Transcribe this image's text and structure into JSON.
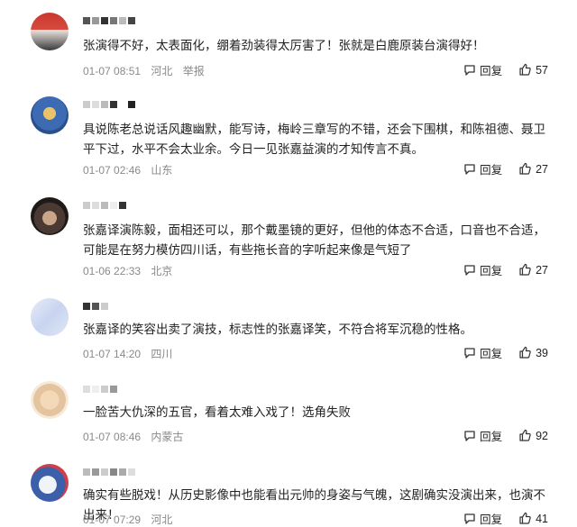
{
  "ui": {
    "reply_label": "回复"
  },
  "comments": [
    {
      "text": "张演得不好，太表面化，绷着劲装得太厉害了！张就是白鹿原装台演得好！",
      "time": "01-07 08:51",
      "location": "河北",
      "report": "举报",
      "likes": "57"
    },
    {
      "text": "具说陈老总说话风趣幽默，能写诗，梅岭三章写的不错，还会下围棋，和陈祖德、聂卫平下过，水平不会太业余。今日一见张嘉益演的才知传言不真。",
      "time": "01-07 02:46",
      "location": "山东",
      "likes": "27"
    },
    {
      "text": "张嘉译演陈毅，面相还可以，那个戴墨镜的更好，但他的体态不合适，口音也不合适，可能是在努力模仿四川话，有些拖长音的字听起来像是气短了",
      "time": "01-06 22:33",
      "location": "北京",
      "likes": "27"
    },
    {
      "text": "张嘉译的笑容出卖了演技，标志性的张嘉译笑，不符合将军沉稳的性格。",
      "time": "01-07 14:20",
      "location": "四川",
      "likes": "39"
    },
    {
      "text": "一脸苦大仇深的五官，看着太难入戏了！选角失败",
      "time": "01-07 08:46",
      "location": "内蒙古",
      "likes": "92"
    },
    {
      "text": "确实有些脱戏！从历史影像中也能看出元帅的身姿与气魄，这剧确实没演出来，也演不出来！",
      "time": "01-07 07:29",
      "location": "河北",
      "likes": "41"
    }
  ]
}
